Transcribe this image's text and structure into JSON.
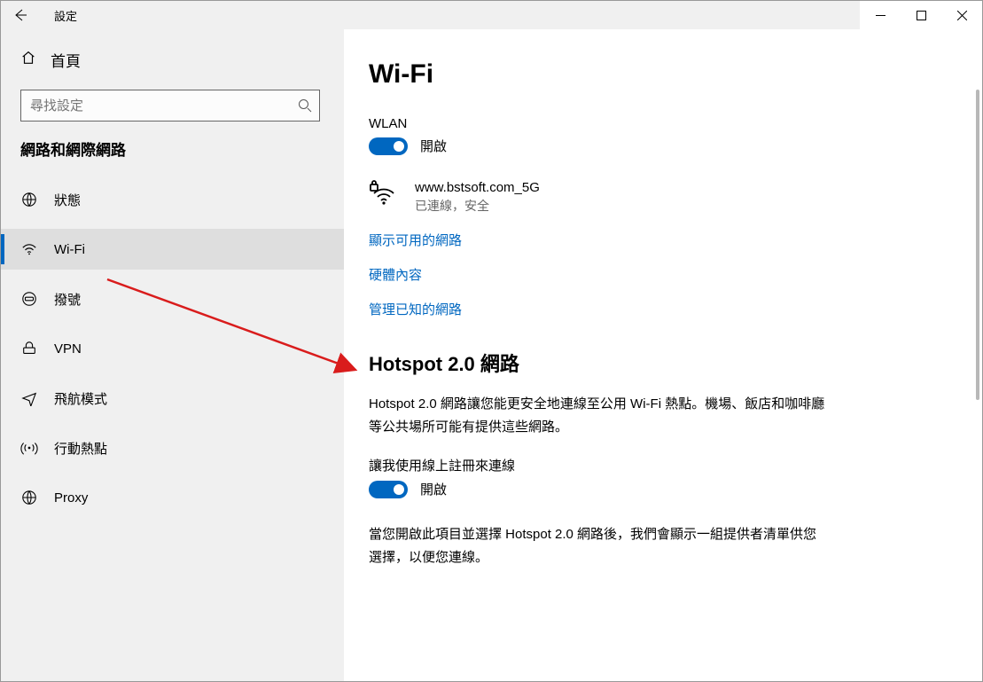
{
  "titlebar": {
    "title": "設定"
  },
  "sidebar": {
    "home": "首頁",
    "search_placeholder": "尋找設定",
    "section": "網路和網際網路",
    "items": [
      {
        "label": "狀態"
      },
      {
        "label": "Wi-Fi"
      },
      {
        "label": "撥號"
      },
      {
        "label": "VPN"
      },
      {
        "label": "飛航模式"
      },
      {
        "label": "行動熱點"
      },
      {
        "label": "Proxy"
      }
    ]
  },
  "content": {
    "page_title": "Wi-Fi",
    "wlan_label": "WLAN",
    "wlan_toggle_state": "開啟",
    "connection": {
      "name": "www.bstsoft.com_5G",
      "status": "已連線，安全"
    },
    "links": {
      "show_available": "顯示可用的網路",
      "hardware_props": "硬體內容",
      "manage_known": "管理已知的網路"
    },
    "hotspot": {
      "heading": "Hotspot 2.0 網路",
      "desc": "Hotspot 2.0 網路讓您能更安全地連線至公用 Wi-Fi 熱點。機場、飯店和咖啡廳等公共場所可能有提供這些網路。",
      "toggle_label": "讓我使用線上註冊來連線",
      "toggle_state": "開啟",
      "note": "當您開啟此項目並選擇 Hotspot 2.0 網路後，我們會顯示一組提供者清單供您選擇，以便您連線。"
    }
  }
}
